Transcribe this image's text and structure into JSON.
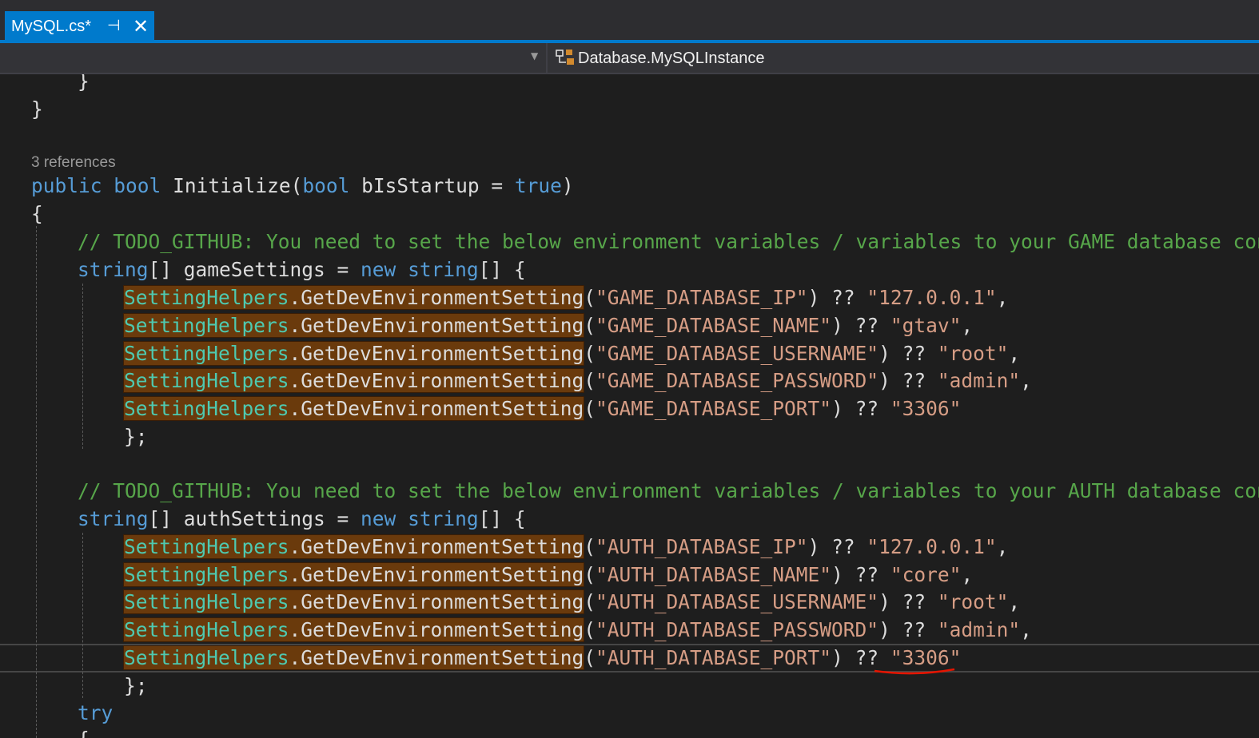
{
  "tab": {
    "title": "MySQL.cs*",
    "pin_glyph": "⊣",
    "close_glyph": "✕"
  },
  "navbar": {
    "member": "Database.MySQLInstance",
    "member_icon": "class-member-icon"
  },
  "editor": {
    "code_lens": "3 references",
    "lines": {
      "l1": "}",
      "l2": "}",
      "l3a": "public",
      "l3b": "bool",
      "l3c": "Initialize(",
      "l3d": "bool",
      "l3e": "bIsStartup = ",
      "l3f": "true",
      "l3g": ")",
      "l4": "{",
      "c1": "// TODO_GITHUB: You need to set the below environment variables / variables to your GAME database con",
      "g0a": "string",
      "g0b": "[] gameSettings = ",
      "g0c": "new",
      "g0d": "string",
      "g0e": "[] {",
      "helper": "SettingHelpers",
      "method": ".GetDevEnvironmentSetting",
      "g1a": "(",
      "g1b": "\"GAME_DATABASE_IP\"",
      "g1c": ") ?? ",
      "g1d": "\"127.0.0.1\"",
      "g1e": ",",
      "g2b": "\"GAME_DATABASE_NAME\"",
      "g2d": "\"gtav\"",
      "g3b": "\"GAME_DATABASE_USERNAME\"",
      "g3d": "\"root\"",
      "g4b": "\"GAME_DATABASE_PASSWORD\"",
      "g4d": "\"admin\"",
      "g5b": "\"GAME_DATABASE_PORT\"",
      "g5d": "\"3306\"",
      "close": "};",
      "c2": "// TODO_GITHUB: You need to set the below environment variables / variables to your AUTH database con",
      "a0b": "[] authSettings = ",
      "a1b": "\"AUTH_DATABASE_IP\"",
      "a1d": "\"127.0.0.1\"",
      "a2b": "\"AUTH_DATABASE_NAME\"",
      "a2d": "\"core\"",
      "a3b": "\"AUTH_DATABASE_USERNAME\"",
      "a3d": "\"root\"",
      "a4b": "\"AUTH_DATABASE_PASSWORD\"",
      "a4d": "\"admin\"",
      "a5b": "\"AUTH_DATABASE_PORT\"",
      "a5d": "\"3306\"",
      "try": "try",
      "last": "{"
    }
  },
  "colors": {
    "keyword": "#569cd6",
    "comment": "#57a64a",
    "string": "#d69d85",
    "type": "#4ec9b0",
    "highlight": "#6a3a0c",
    "accent": "#007acc",
    "error_squiggle": "#e51400"
  }
}
